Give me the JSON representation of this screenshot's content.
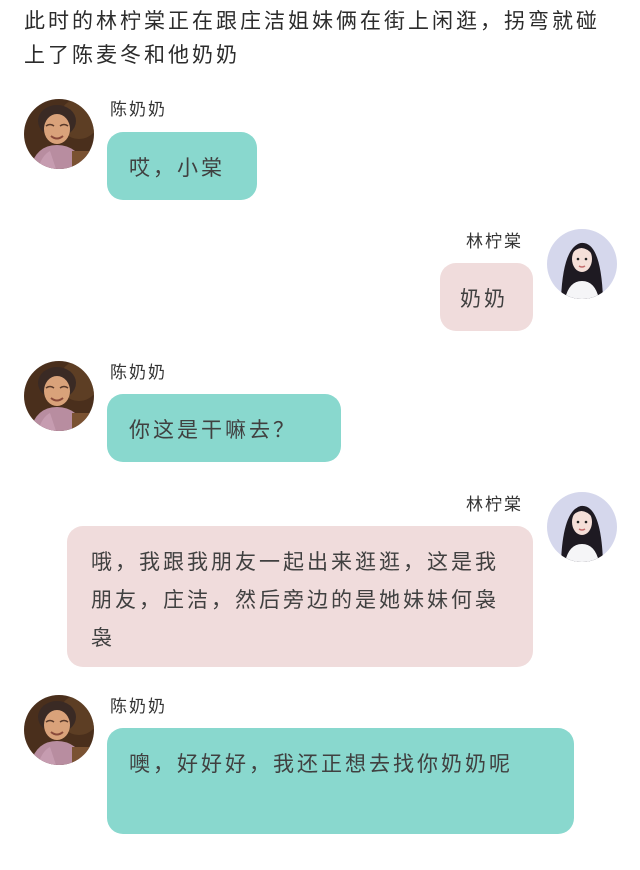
{
  "intro": "此时的林柠棠正在跟庄洁姐妹俩在街上闲逛，拐弯就碰上了陈麦冬和他奶奶",
  "messages": [
    {
      "speaker": "陈奶奶",
      "side": "left",
      "text": "哎，小棠"
    },
    {
      "speaker": "林柠棠",
      "side": "right",
      "text": "奶奶"
    },
    {
      "speaker": "陈奶奶",
      "side": "left",
      "text": "你这是干嘛去？"
    },
    {
      "speaker": "林柠棠",
      "side": "right",
      "text": "哦，我跟我朋友一起出来逛逛，这是我朋友，庄洁，然后旁边的是她妹妹何袅袅"
    },
    {
      "speaker": "陈奶奶",
      "side": "left",
      "text": "噢，好好好，我还正想去找你奶奶呢"
    }
  ],
  "colors": {
    "left_bubble": "#89d8ce",
    "right_bubble": "#f0dcdc",
    "background": "#ffffff"
  },
  "icons": {
    "grandma_avatar": "elderly-woman-photo-avatar",
    "girl_avatar": "young-woman-photo-avatar"
  }
}
